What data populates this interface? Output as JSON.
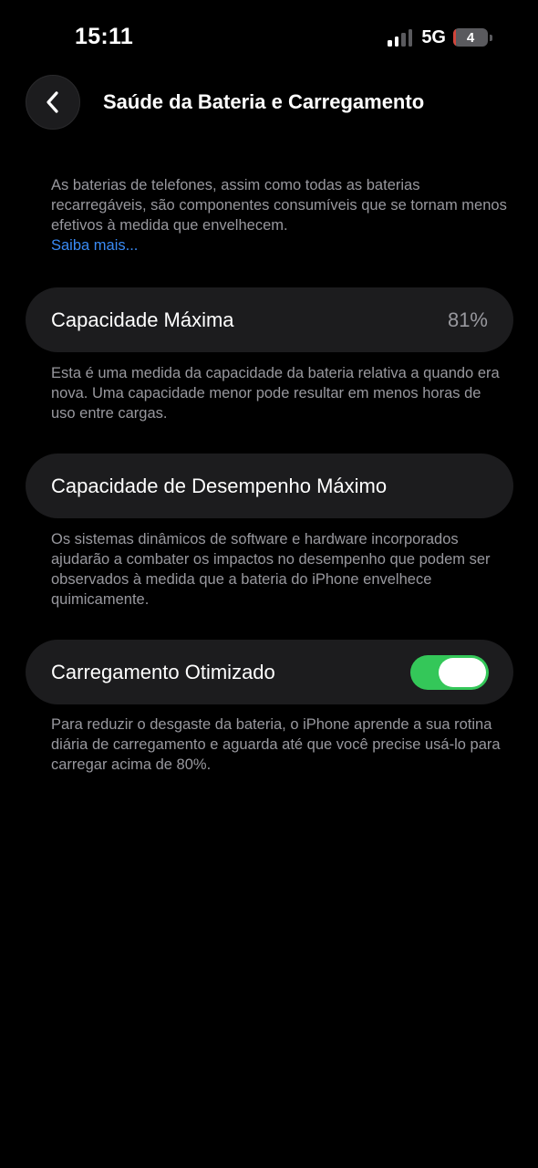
{
  "status_bar": {
    "time": "15:11",
    "network": "5G",
    "battery_level": "4",
    "battery_fraction": 0.04,
    "signal_bars_active": 2,
    "signal_bars_total": 4,
    "icons": [
      "cellular-signal-icon",
      "battery-icon"
    ]
  },
  "nav": {
    "back_icon": "chevron-left-icon",
    "title": "Saúde da Bateria e Carregamento"
  },
  "intro": {
    "text": "As baterias de telefones, assim como todas as baterias recarregáveis, são componentes consumíveis que se tornam menos efetivos à medida que envelhecem.",
    "link_label": "Saiba mais..."
  },
  "maximum_capacity": {
    "label": "Capacidade Máxima",
    "value": "81%",
    "footnote": "Esta é uma medida da capacidade da bateria relativa a quando era nova. Uma capacidade menor pode resultar em menos horas de uso entre cargas."
  },
  "peak_performance": {
    "label": "Capacidade de Desempenho Máximo",
    "footnote": "Os sistemas dinâmicos de software e hardware incorporados ajudarão a combater os impactos no desempenho que podem ser observados à medida que a bateria do iPhone envelhece quimicamente."
  },
  "optimized_charging": {
    "label": "Carregamento Otimizado",
    "enabled": true,
    "footnote": "Para reduzir o desgaste da bateria, o iPhone aprende a sua rotina diária de carregamento e aguarda até que você precise usá-lo para carregar acima de 80%."
  },
  "colors": {
    "background": "#000000",
    "card": "#1c1c1e",
    "secondary_text": "#98989e",
    "link": "#3a8bf5",
    "toggle_on": "#34c759",
    "battery_low": "#d1453b"
  }
}
